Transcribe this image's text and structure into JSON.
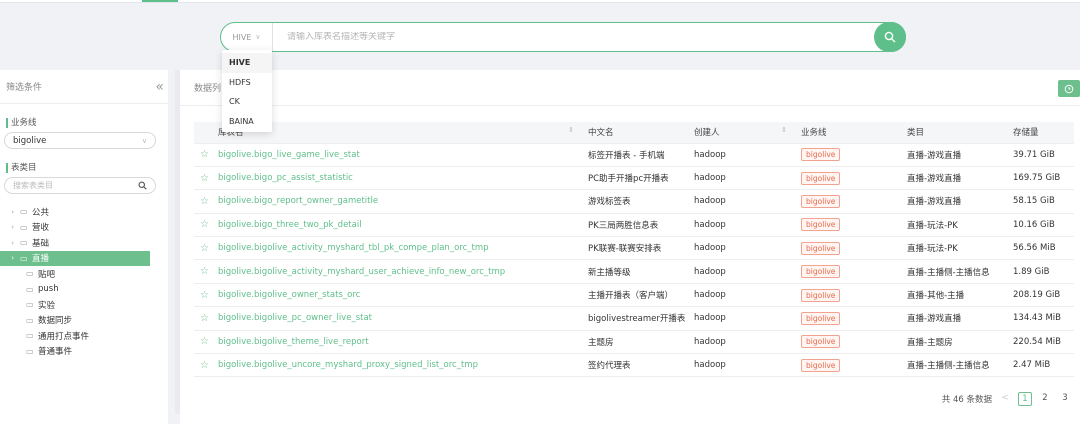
{
  "search": {
    "type_selected": "HIVE",
    "placeholder": "请输入库表名描述等关键字",
    "type_options": [
      "HIVE",
      "HDFS",
      "CK",
      "BAINA"
    ]
  },
  "sidebar": {
    "title": "筛选条件",
    "business_line_label": "业务线",
    "business_line_value": "bigolive",
    "category_label": "表类目",
    "category_search_placeholder": "搜索表类目",
    "tree": [
      {
        "label": "公共",
        "expandable": true,
        "active": false
      },
      {
        "label": "营收",
        "expandable": true,
        "active": false
      },
      {
        "label": "基础",
        "expandable": true,
        "active": false
      },
      {
        "label": "直播",
        "expandable": true,
        "active": true
      },
      {
        "label": "贴吧",
        "expandable": false,
        "active": false
      },
      {
        "label": "push",
        "expandable": false,
        "active": false
      },
      {
        "label": "实验",
        "expandable": false,
        "active": false
      },
      {
        "label": "数据同步",
        "expandable": false,
        "active": false
      },
      {
        "label": "通用打点事件",
        "expandable": false,
        "active": false
      },
      {
        "label": "普通事件",
        "expandable": false,
        "active": false
      }
    ]
  },
  "main": {
    "title": "数据列"
  },
  "table": {
    "headers": [
      "库表名",
      "中文名",
      "创建人",
      "业务线",
      "类目",
      "存储量"
    ],
    "rows": [
      [
        "bigolive.bigo_live_game_live_stat",
        "标签开播表 - 手机端",
        "hadoop",
        "bigolive",
        "直播-游戏直播",
        "39.71 GiB"
      ],
      [
        "bigolive.bigo_pc_assist_statistic",
        "PC助手开播pc开播表",
        "hadoop",
        "bigolive",
        "直播-游戏直播",
        "169.75 GiB"
      ],
      [
        "bigolive.bigo_report_owner_gametitle",
        "游戏标签表",
        "hadoop",
        "bigolive",
        "直播-游戏直播",
        "58.15 GiB"
      ],
      [
        "bigolive.bigo_three_two_pk_detail",
        "PK三局两胜信息表",
        "hadoop",
        "bigolive",
        "直播-玩法-PK",
        "10.16 GiB"
      ],
      [
        "bigolive.bigolive_activity_myshard_tbl_pk_compe_plan_orc_tmp",
        "PK联赛-联赛安排表",
        "hadoop",
        "bigolive",
        "直播-玩法-PK",
        "56.56 MiB"
      ],
      [
        "bigolive.bigolive_activity_myshard_user_achieve_info_new_orc_tmp",
        "新主播等级",
        "hadoop",
        "bigolive",
        "直播-主播侧-主播信息",
        "1.89 GiB"
      ],
      [
        "bigolive.bigolive_owner_stats_orc",
        "主播开播表（客户端）",
        "hadoop",
        "bigolive",
        "直播-其他-主播",
        "208.19 GiB"
      ],
      [
        "bigolive.bigolive_pc_owner_live_stat",
        "bigolivestreamer开播表",
        "hadoop",
        "bigolive",
        "直播-游戏直播",
        "134.43 MiB"
      ],
      [
        "bigolive.bigolive_theme_live_report",
        "主题房",
        "hadoop",
        "bigolive",
        "直播-主题房",
        "220.54 MiB"
      ],
      [
        "bigolive.bigolive_uncore_myshard_proxy_signed_list_orc_tmp",
        "签约代理表",
        "hadoop",
        "bigolive",
        "直播-主播侧-主播信息",
        "2.47 MiB"
      ]
    ]
  },
  "pagination": {
    "total_text": "共 46 条数据",
    "prev": "<",
    "pages": [
      "1",
      "2",
      "3"
    ],
    "current": "1"
  },
  "colors": {
    "accent": "#5fbf8a",
    "tag_border": "#f2a28e",
    "tag_text": "#e86b4d"
  }
}
